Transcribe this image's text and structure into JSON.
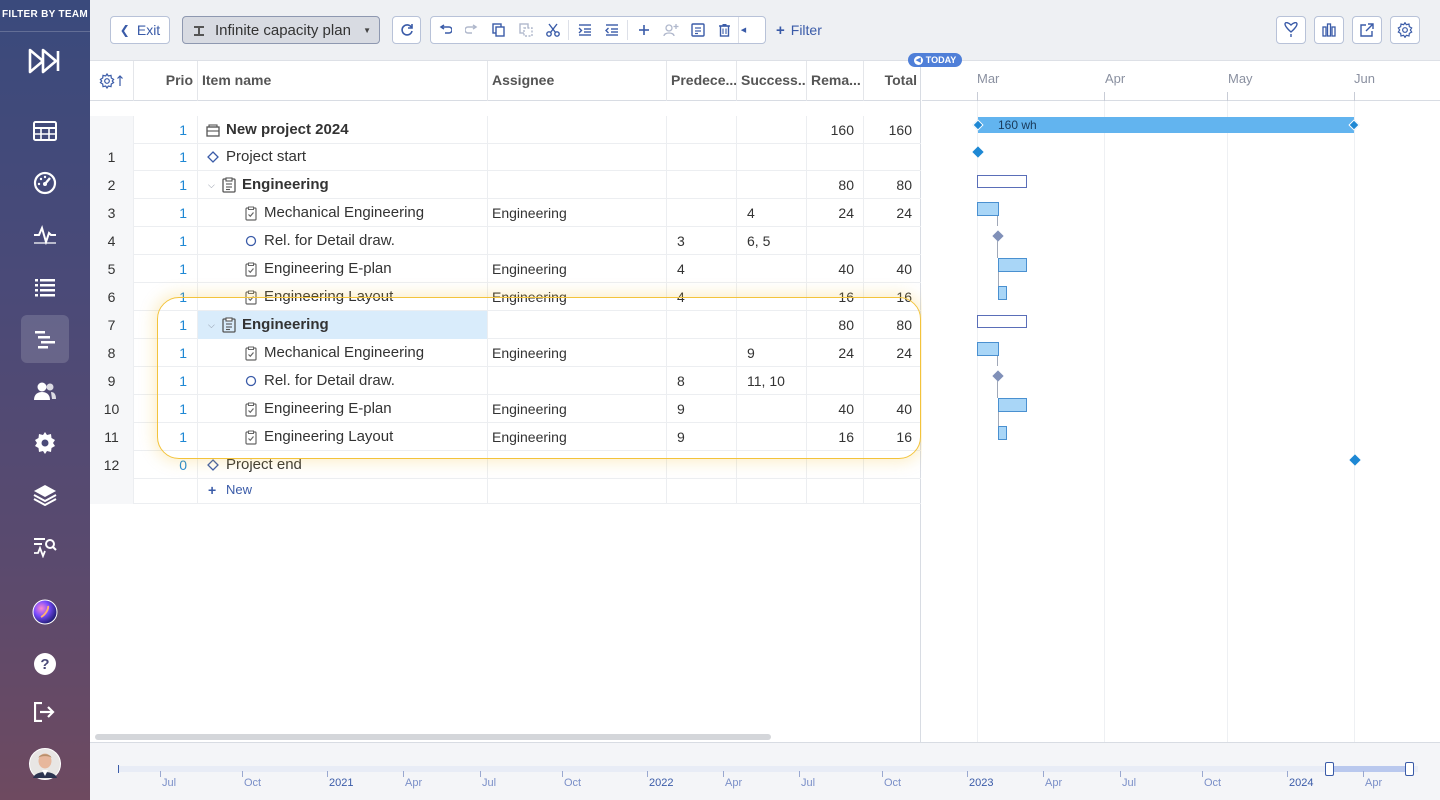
{
  "sidebar": {
    "filter_label": "FILTER BY TEAM",
    "items": [
      {
        "icon": "logo-icon"
      },
      {
        "icon": "table-icon"
      },
      {
        "icon": "dashboard-icon"
      },
      {
        "icon": "activity-icon"
      },
      {
        "icon": "list-icon"
      },
      {
        "icon": "gantt-icon",
        "active": true
      },
      {
        "icon": "users-icon"
      },
      {
        "icon": "settings-icon"
      },
      {
        "icon": "layers-icon"
      },
      {
        "icon": "search-analytics-icon"
      },
      {
        "icon": "app-orb-icon"
      },
      {
        "icon": "help-icon"
      },
      {
        "icon": "logout-icon"
      },
      {
        "icon": "avatar"
      }
    ]
  },
  "toolbar": {
    "exit_label": "Exit",
    "plan_label": "Infinite capacity plan",
    "filter_label": "Filter"
  },
  "grid": {
    "headers": {
      "prio": "Prio",
      "name": "Item name",
      "assignee": "Assignee",
      "predecessors": "Predece...",
      "successors": "Success...",
      "remaining": "Rema...",
      "total": "Total"
    },
    "rows": [
      {
        "idx": "",
        "prio": "1",
        "name": "New project 2024",
        "type": "project",
        "indent": 0,
        "assignee": "",
        "pred": "",
        "succ": "",
        "rem": "160",
        "tot": "160"
      },
      {
        "idx": "1",
        "prio": "1",
        "name": "Project start",
        "type": "milestone",
        "indent": 0,
        "assignee": "",
        "pred": "",
        "succ": "",
        "rem": "",
        "tot": ""
      },
      {
        "idx": "2",
        "prio": "1",
        "name": "Engineering",
        "type": "group",
        "indent": 0,
        "assignee": "",
        "pred": "",
        "succ": "",
        "rem": "80",
        "tot": "80"
      },
      {
        "idx": "3",
        "prio": "1",
        "name": "Mechanical Engineering",
        "type": "task",
        "indent": 1,
        "assignee": "Engineering",
        "pred": "",
        "succ": "4",
        "rem": "24",
        "tot": "24"
      },
      {
        "idx": "4",
        "prio": "1",
        "name": "Rel. for Detail draw.",
        "type": "circle",
        "indent": 1,
        "assignee": "",
        "pred": "3",
        "succ": "6, 5",
        "rem": "",
        "tot": ""
      },
      {
        "idx": "5",
        "prio": "1",
        "name": "Engineering E-plan",
        "type": "task",
        "indent": 1,
        "assignee": "Engineering",
        "pred": "4",
        "succ": "",
        "rem": "40",
        "tot": "40"
      },
      {
        "idx": "6",
        "prio": "1",
        "name": "Engineering Layout",
        "type": "task",
        "indent": 1,
        "assignee": "Engineering",
        "pred": "4",
        "succ": "",
        "rem": "16",
        "tot": "16"
      },
      {
        "idx": "7",
        "prio": "1",
        "name": "Engineering",
        "type": "group",
        "indent": 0,
        "assignee": "",
        "pred": "",
        "succ": "",
        "rem": "80",
        "tot": "80"
      },
      {
        "idx": "8",
        "prio": "1",
        "name": "Mechanical Engineering",
        "type": "task",
        "indent": 1,
        "assignee": "Engineering",
        "pred": "",
        "succ": "9",
        "rem": "24",
        "tot": "24"
      },
      {
        "idx": "9",
        "prio": "1",
        "name": "Rel. for Detail draw.",
        "type": "circle",
        "indent": 1,
        "assignee": "",
        "pred": "8",
        "succ": "11, 10",
        "rem": "",
        "tot": ""
      },
      {
        "idx": "10",
        "prio": "1",
        "name": "Engineering E-plan",
        "type": "task",
        "indent": 1,
        "assignee": "Engineering",
        "pred": "9",
        "succ": "",
        "rem": "40",
        "tot": "40"
      },
      {
        "idx": "11",
        "prio": "1",
        "name": "Engineering Layout",
        "type": "task",
        "indent": 1,
        "assignee": "Engineering",
        "pred": "9",
        "succ": "",
        "rem": "16",
        "tot": "16"
      },
      {
        "idx": "12",
        "prio": "0",
        "name": "Project end",
        "type": "milestone",
        "indent": 0,
        "assignee": "",
        "pred": "",
        "succ": "",
        "rem": "",
        "tot": ""
      }
    ],
    "new_label": "New"
  },
  "gantt": {
    "today_label": "TODAY",
    "months": [
      "Mar",
      "Apr",
      "May",
      "Jun"
    ],
    "summary_label": "160 wh"
  },
  "timeline": {
    "labels": [
      "Jul",
      "Oct",
      "2021",
      "Apr",
      "Jul",
      "Oct",
      "2022",
      "Apr",
      "Jul",
      "Oct",
      "2023",
      "Apr",
      "Jul",
      "Oct",
      "2024",
      "Apr"
    ]
  },
  "colors": {
    "accent": "#1e88d4",
    "highlight": "#f3c33b",
    "bar_fill": "#a9d6f7",
    "summary_bar": "#62b4ef"
  }
}
